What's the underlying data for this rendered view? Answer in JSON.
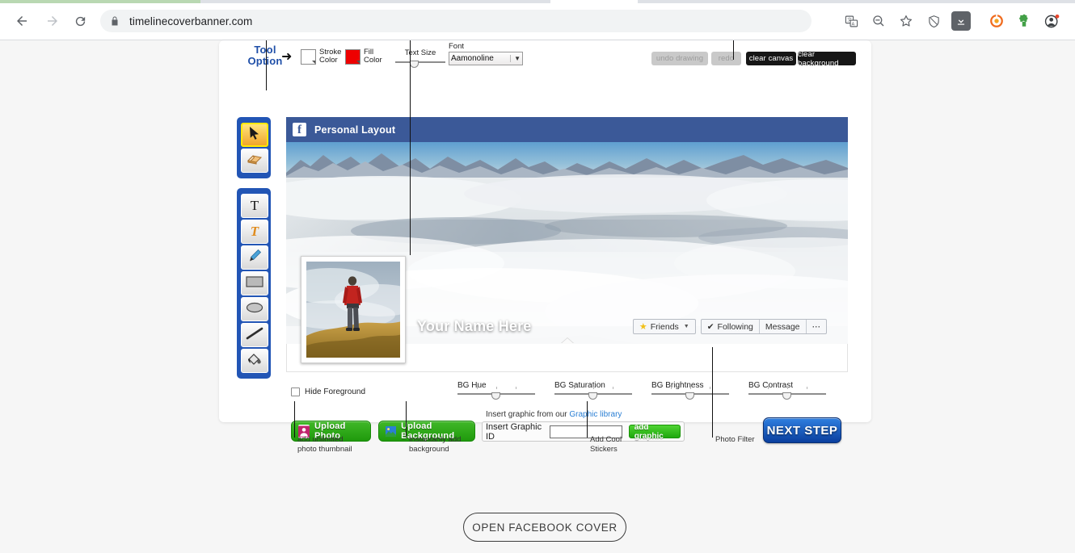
{
  "browser": {
    "url": "timelinecoverbanner.com",
    "nav": {
      "back": "back-arrow",
      "forward": "forward-arrow",
      "reload": "reload"
    },
    "lock_icon": "lock-icon",
    "toolbar_icons": [
      "translate-icon",
      "zoom-out-icon",
      "bookmark-star-icon",
      "shield-icon",
      "download-icon",
      "orange-extension-icon",
      "puzzle-extension-icon",
      "profile-avatar-icon"
    ]
  },
  "editor": {
    "tool_option_label": "Tool\nOption",
    "tool_option_line1": "Tool",
    "tool_option_line2": "Option",
    "arrow_glyph": "➜",
    "stroke_color": {
      "label_line1": "Stroke",
      "label_line2": "Color",
      "color": "#ffffff"
    },
    "fill_color": {
      "label_line1": "Fill",
      "label_line2": "Color",
      "color": "#ee0000"
    },
    "text_size": {
      "label": "Text Size",
      "value": 35
    },
    "font": {
      "label": "Font",
      "selected": "Aamonoline",
      "caret": "▼"
    },
    "buttons": {
      "undo": "undo drawing",
      "redo": "redo",
      "clear_canvas": "clear canvas",
      "clear_background": "clear background"
    },
    "tools_top": [
      {
        "name": "select-tool",
        "icon": "cursor-arrow-icon",
        "selected": true
      },
      {
        "name": "eraser-tool",
        "icon": "eraser-icon",
        "selected": false
      }
    ],
    "tools_bottom": [
      {
        "name": "text-tool",
        "icon": "text-t-icon",
        "selected": false
      },
      {
        "name": "fancy-text-tool",
        "icon": "styled-text-icon",
        "selected": false
      },
      {
        "name": "pen-tool",
        "icon": "pen-icon",
        "selected": false
      },
      {
        "name": "rectangle-tool",
        "icon": "rectangle-icon",
        "selected": false
      },
      {
        "name": "ellipse-tool",
        "icon": "ellipse-icon",
        "selected": false
      },
      {
        "name": "line-tool",
        "icon": "line-icon",
        "selected": false
      },
      {
        "name": "fill-tool",
        "icon": "paint-bucket-icon",
        "selected": false
      }
    ]
  },
  "preview": {
    "header_title": "Personal Layout",
    "fb_logo": "facebook-f-icon",
    "name_overlay": "Your Name Here",
    "actions": {
      "friends": "Friends",
      "friends_caret": "▼",
      "star": "★",
      "following": "Following",
      "check": "✔",
      "message": "Message",
      "more": "⋯"
    },
    "cover_alt": "mountain-peaks-above-clouds",
    "thumb_alt": "hiker-in-red-jacket-on-hill"
  },
  "controls": {
    "hide_foreground": {
      "label": "Hide Foreground",
      "checked": false
    },
    "sliders": [
      {
        "label": "BG Hue",
        "value": 50
      },
      {
        "label": "BG Saturation",
        "value": 50
      },
      {
        "label": "BG Brightness",
        "value": 50
      },
      {
        "label": "BG Contrast",
        "value": 50
      }
    ]
  },
  "actions": {
    "upload_photo": "Upload  Photo",
    "upload_photo_icon": "person-photo-icon",
    "upload_background": "Upload Background",
    "upload_background_icon": "image-icon",
    "graphic_intro": "Insert graphic from our ",
    "graphic_library_link": "Graphic library",
    "graphic_id_label": "Insert Graphic ID",
    "graphic_id_value": "",
    "graphic_id_placeholder": "",
    "add_graphic": "add graphic",
    "next_step": "NEXT STEP"
  },
  "annotations": [
    {
      "text_line1": "add unlimited",
      "text_line2": "photo thumbnail"
    },
    {
      "text_line1": "Instantanly add",
      "text_line2": "background"
    },
    {
      "text_line1": "Add Cool",
      "text_line2": "Stickers"
    },
    {
      "text_line1": "Photo Filter",
      "text_line2": ""
    }
  ],
  "cta": {
    "open_cover": "OPEN FACEBOOK COVER"
  },
  "colors": {
    "fb_blue": "#3b5998",
    "accent_blue": "#1f4fa8",
    "green": "#1f9a0c",
    "link": "#2a7fd4"
  }
}
